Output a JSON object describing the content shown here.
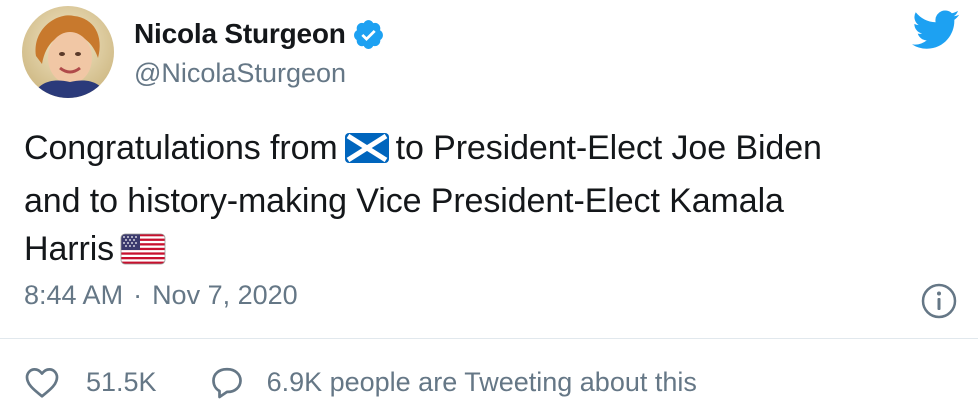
{
  "author": {
    "display_name": "Nicola Sturgeon",
    "handle": "@NicolaSturgeon",
    "verified": true,
    "avatar_icon": "profile-photo"
  },
  "tweet": {
    "line1_before_flag": "Congratulations from",
    "line1_after_flag": "to President-Elect Joe Biden",
    "line2": "and to history-making Vice President-Elect Kamala",
    "line3": "Harris",
    "flag1_icon": "scotland-flag-icon",
    "flag2_icon": "usa-flag-icon"
  },
  "meta": {
    "time": "8:44 AM",
    "separator": "·",
    "date": "Nov 7, 2020"
  },
  "actions": {
    "like_count": "51.5K",
    "conversation_text": "6.9K people are Tweeting about this"
  },
  "colors": {
    "twitter_blue": "#1da1f2",
    "text": "#14171a",
    "secondary": "#657786",
    "divider": "#e1e8ed"
  }
}
